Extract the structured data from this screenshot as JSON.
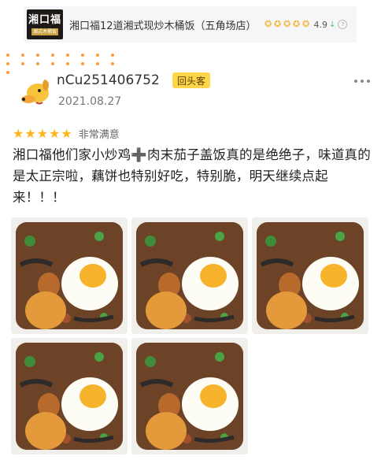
{
  "store": {
    "logo_text": "湘口福",
    "logo_subtext": "湘式木桶饭",
    "name": "湘口福12道湘式现炒木桶饭（五角场店）",
    "score": "4.9",
    "trend_icon": "arrow-down-icon",
    "info_icon": "question-icon"
  },
  "review": {
    "username": "nCu251406752",
    "badge": "回头客",
    "date": "2021.08.27",
    "rating_stars": 5,
    "rating_label": "非常满意",
    "text": "湘口福他们家小炒鸡➕肉末茄子盖饭真的是绝绝子，味道真的是太正宗啦，藕饼也特别好吃，特别脆，明天继续点起来！！！",
    "photo_count": 5
  },
  "colors": {
    "star": "#ffb41e",
    "badge_bg": "#ffd54a",
    "dots": "#ff9a3c"
  }
}
